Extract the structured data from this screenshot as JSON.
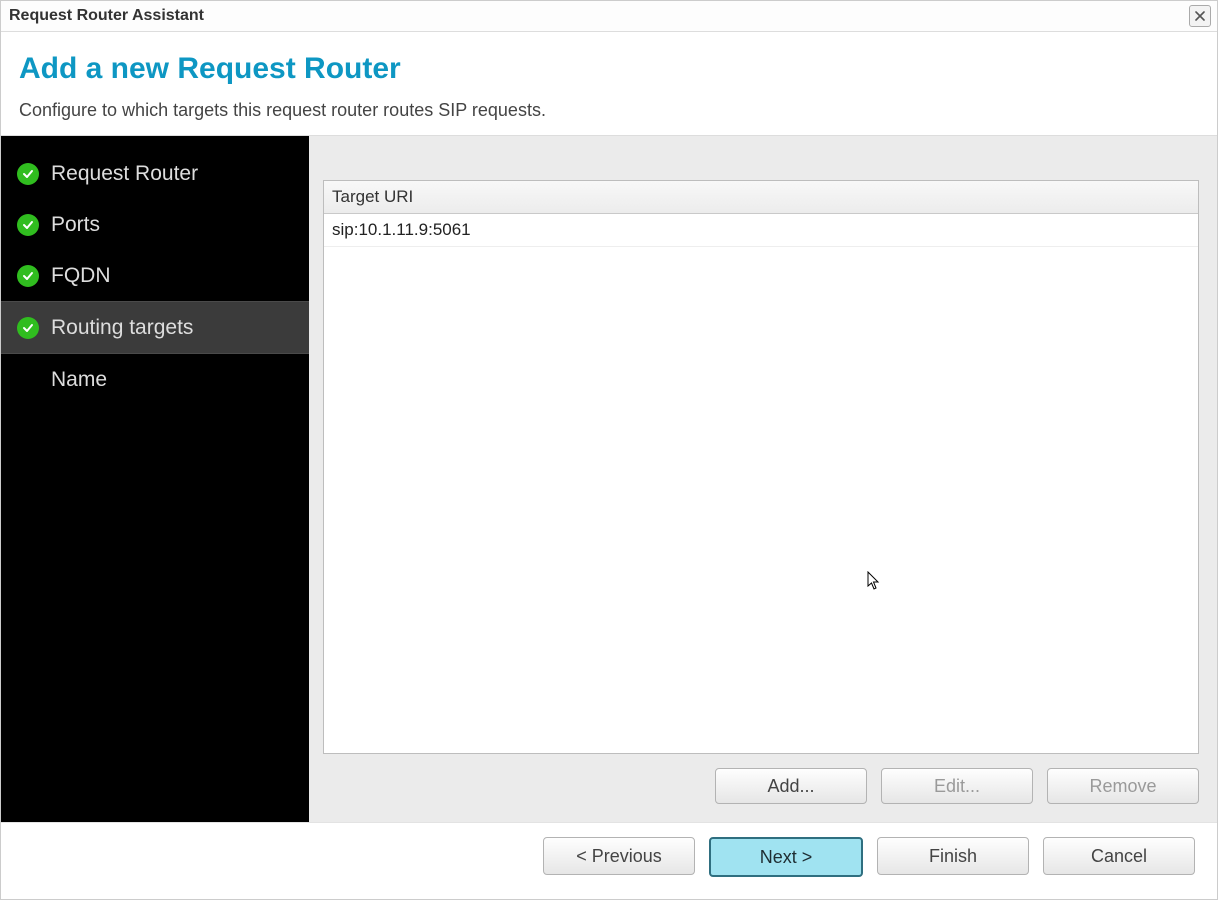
{
  "window": {
    "title": "Request Router Assistant"
  },
  "header": {
    "title": "Add a new Request Router",
    "subtitle": "Configure to which targets this request router routes SIP requests."
  },
  "sidebar": {
    "items": [
      {
        "label": "Request Router",
        "done": true
      },
      {
        "label": "Ports",
        "done": true
      },
      {
        "label": "FQDN",
        "done": true
      },
      {
        "label": "Routing targets",
        "done": true,
        "active": true
      },
      {
        "label": "Name",
        "done": false
      }
    ]
  },
  "table": {
    "column_header": "Target URI",
    "rows": [
      {
        "uri": "sip:10.1.11.9:5061"
      }
    ]
  },
  "content_buttons": {
    "add": "Add...",
    "edit": "Edit...",
    "remove": "Remove"
  },
  "footer_buttons": {
    "previous": "< Previous",
    "next": "Next >",
    "finish": "Finish",
    "cancel": "Cancel"
  }
}
